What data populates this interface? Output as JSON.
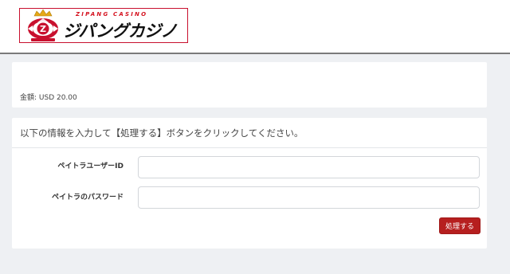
{
  "header": {
    "logo_subtitle": "ZIPANG CASINO",
    "logo_title": "ジパングカジノ"
  },
  "amount": {
    "text": "金額: USD 20.00"
  },
  "form": {
    "instruction": "以下の情報を入力して【処理する】ボタンをクリックしてください。",
    "user_id_label": "ペイトラユーザーID",
    "user_id_value": "",
    "password_label": "ペイトラのパスワード",
    "password_value": "",
    "submit_label": "処理する"
  },
  "colors": {
    "brand_red": "#c8102e",
    "button_red": "#b61f1f",
    "background": "#eef0f3"
  }
}
